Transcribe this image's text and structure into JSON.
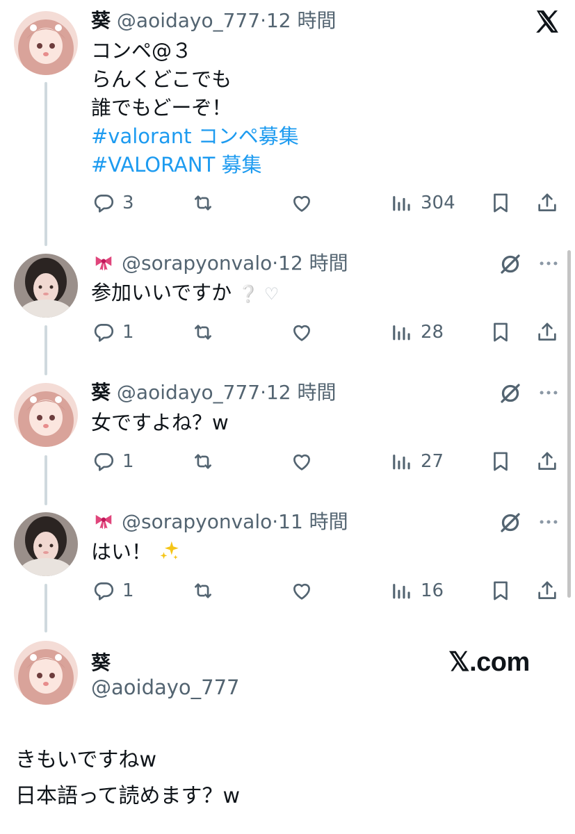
{
  "colors": {
    "text": "#0f1419",
    "muted": "#536471",
    "link": "#1d9bf0",
    "thread": "#cfd9de"
  },
  "tweets": [
    {
      "name": "葵",
      "handle": "@aoidayo_777",
      "separator": "·",
      "time": "12 時間",
      "lines": [
        "コンペ@３",
        "らんくどこでも",
        "誰でもどーぞ！"
      ],
      "hashtags": [
        "#valorant コンペ募集",
        "#VALORANT 募集"
      ],
      "replies": "3",
      "views": "304"
    },
    {
      "name_emoji": "ribbon",
      "handle": "@sorapyonvalo",
      "separator": "·",
      "time": "12 時間",
      "text": "参加いいですか",
      "text_suffix_emoji": "❔ ♡",
      "replies": "1",
      "views": "28"
    },
    {
      "name": "葵",
      "handle": "@aoidayo_777",
      "separator": "·",
      "time": "12 時間",
      "text": "女ですよね？w",
      "replies": "1",
      "views": "27"
    },
    {
      "name_emoji": "ribbon",
      "handle": "@sorapyonvalo",
      "separator": "·",
      "time": "11 時間",
      "text": "はい！",
      "text_suffix_emoji": "sparkles",
      "replies": "1",
      "views": "16"
    }
  ],
  "final_post": {
    "name": "葵",
    "handle": "@aoidayo_777",
    "brand": "𝕏.com",
    "lines": [
      "きもいですねw",
      "日本語って読めます？w"
    ]
  },
  "icons": [
    "x-logo-icon",
    "reply-icon",
    "retweet-icon",
    "like-icon",
    "views-icon",
    "bookmark-icon",
    "share-icon",
    "grok-icon",
    "more-icon"
  ]
}
